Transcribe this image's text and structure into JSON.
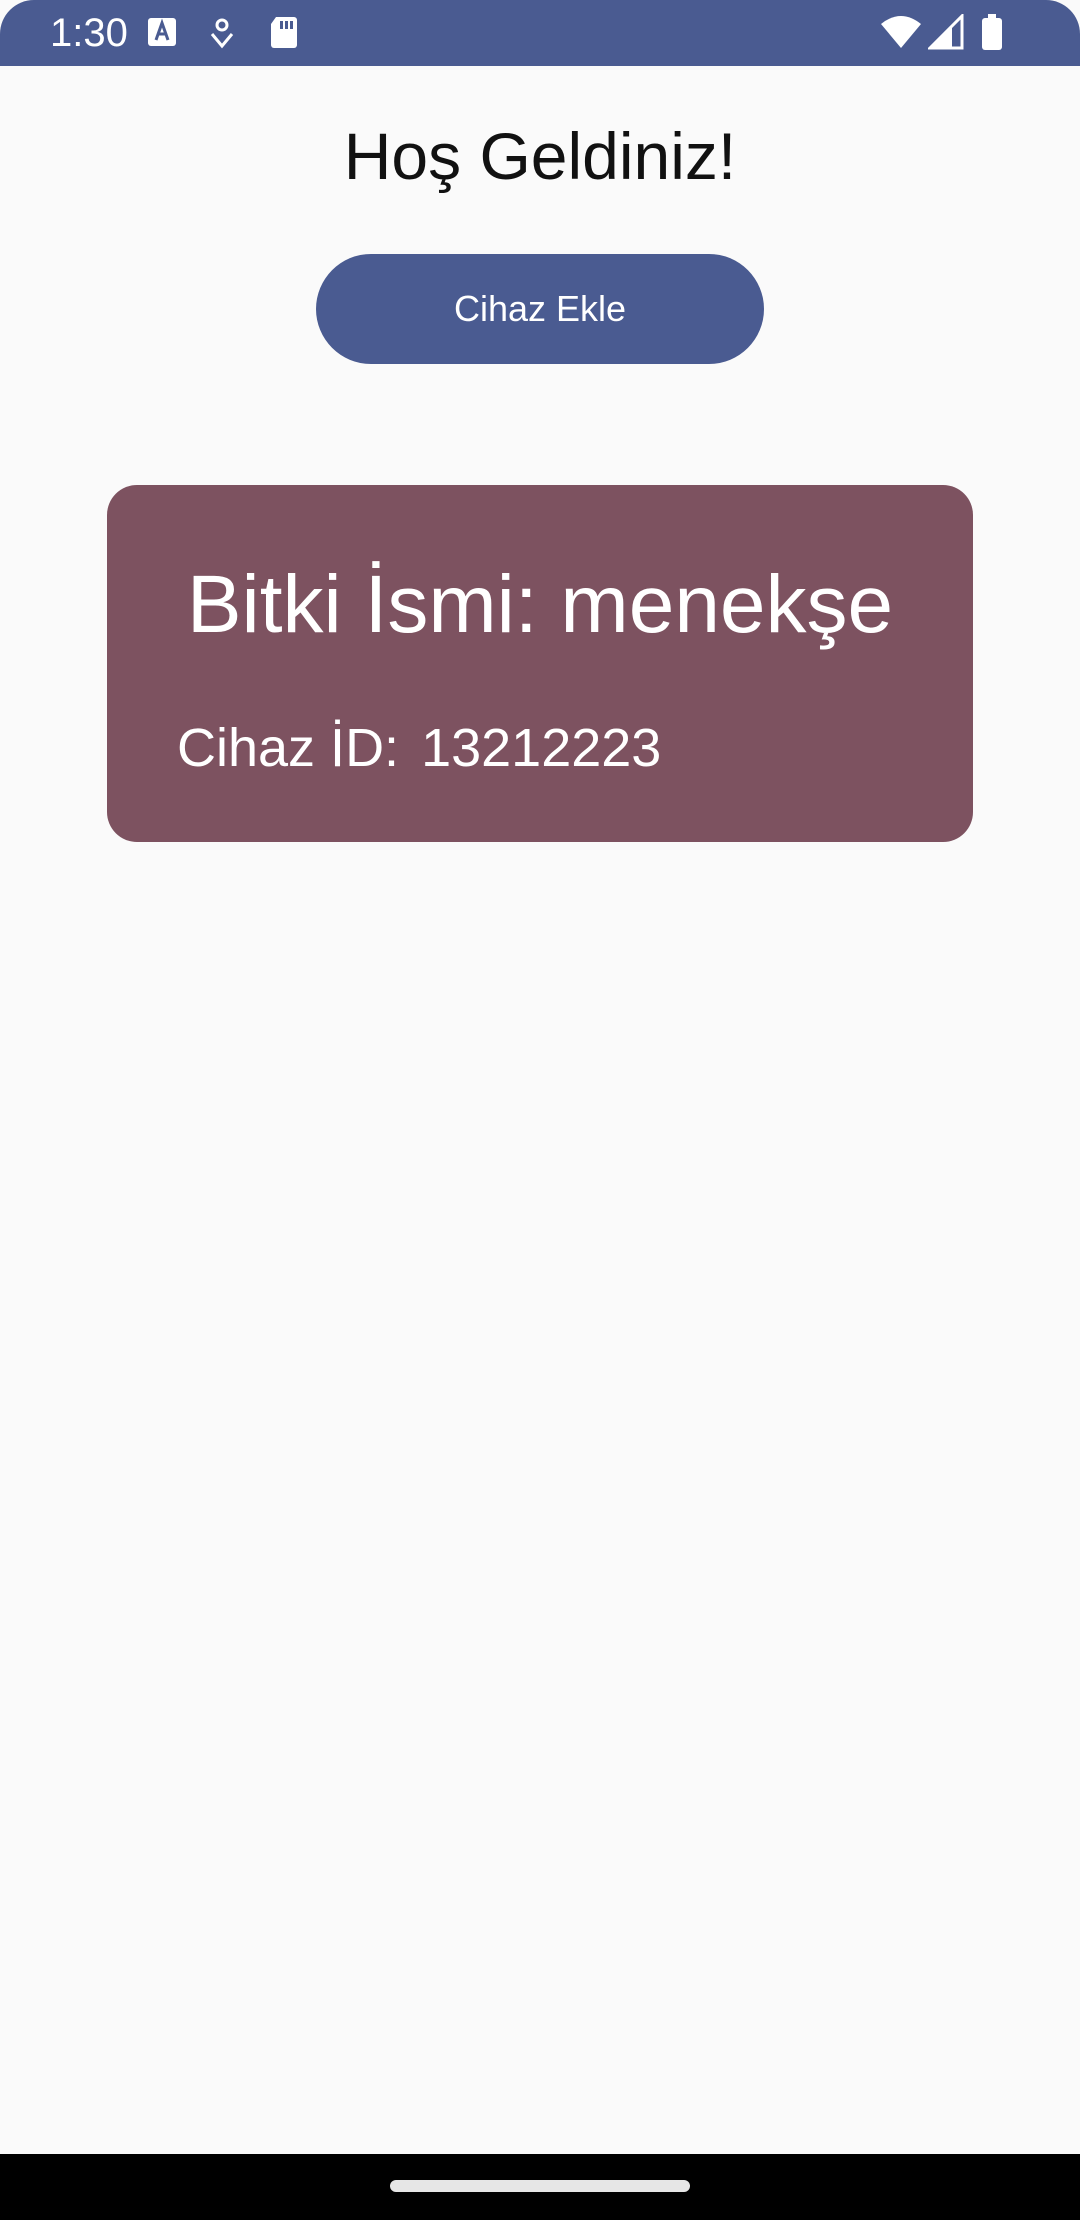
{
  "status_bar": {
    "time": "1:30",
    "icons": [
      "keyboard-a-icon",
      "location-pin-icon",
      "sd-card-icon",
      "wifi-icon",
      "signal-icon",
      "battery-icon"
    ]
  },
  "main": {
    "title": "Hoş Geldiniz!",
    "add_device_button_label": "Cihaz Ekle"
  },
  "device_card": {
    "title": "Bitki İsmi: menekşe",
    "id_label": "Cihaz İD:",
    "id_value": "13212223"
  },
  "colors": {
    "primary": "#4a5b91",
    "card": "#7d5260",
    "background": "#fafafa"
  }
}
